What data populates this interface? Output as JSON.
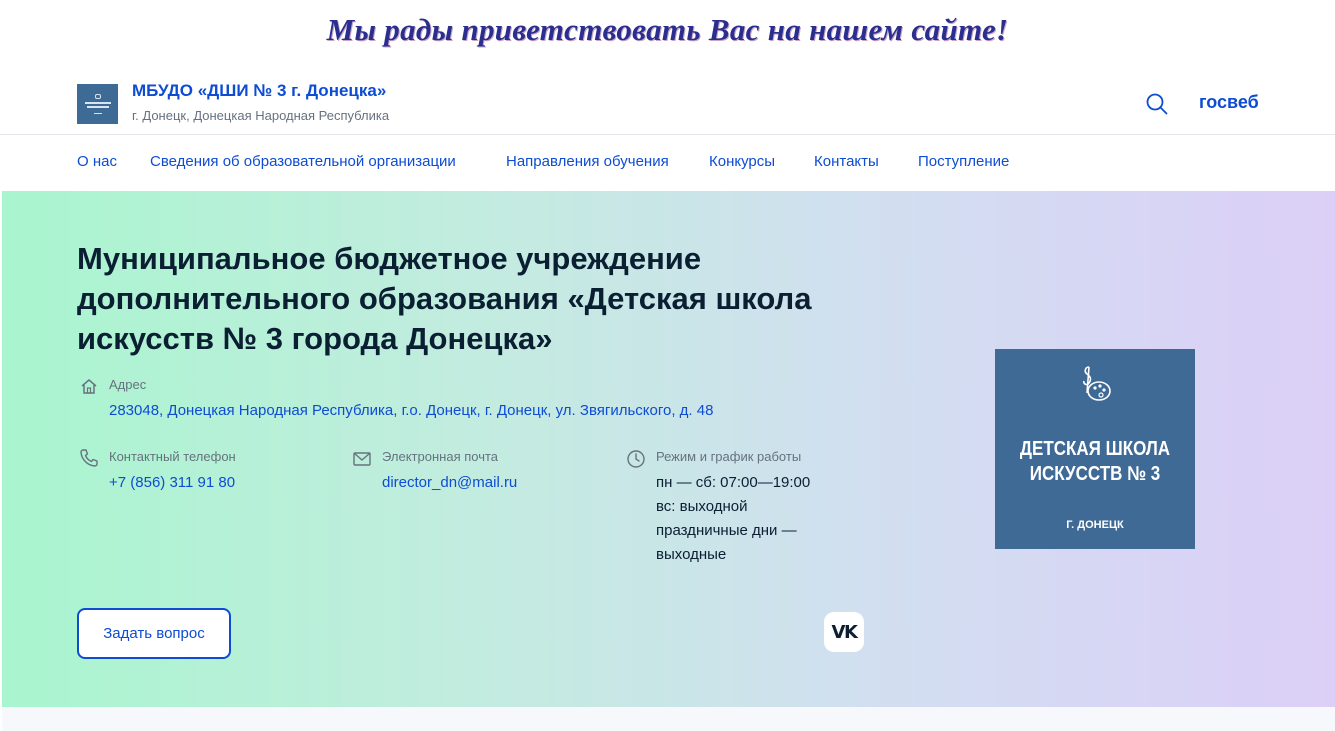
{
  "welcome_banner": "Мы рады приветствовать Вас на нашем сайте!",
  "header": {
    "org_name": "МБУДО «ДШИ № 3 г. Донецка»",
    "org_subtitle": "г. Донецк, Донецкая Народная Республика",
    "search_icon": "search-icon",
    "gosweb_label": "госвеб"
  },
  "nav": {
    "items": [
      {
        "label": "О нас"
      },
      {
        "label": "Сведения об образовательной организации"
      },
      {
        "label": "Направления обучения"
      },
      {
        "label": "Конкурсы"
      },
      {
        "label": "Контакты"
      },
      {
        "label": "Поступление"
      }
    ]
  },
  "hero": {
    "title": "Муниципальное бюджетное учреждение дополнительного образования «Детская школа искусств № 3 города Донецка»",
    "address": {
      "icon": "home-icon",
      "label": "Адрес",
      "value": "283048, Донецкая Народная Республика, г.о. Донецк, г. Донецк, ул. Звягильского, д. 48"
    },
    "phone": {
      "icon": "phone-icon",
      "label": "Контактный телефон",
      "value": "+7 (856) 311 91 80"
    },
    "email": {
      "icon": "mail-icon",
      "label": "Электронная почта",
      "value": "director_dn@mail.ru"
    },
    "schedule": {
      "icon": "clock-icon",
      "label": "Режим и график работы",
      "lines": [
        "пн — сб: 07:00—19:00",
        "вс: выходной",
        "праздничные дни —",
        "выходные"
      ]
    },
    "ask_button": "Задать вопрос",
    "vk_label": "VK",
    "card": {
      "icon": "music-palette-icon",
      "title_line1": "ДЕТСКАЯ ШКОЛА",
      "title_line2": "ИСКУССТВ № 3",
      "subtitle": "Г. ДОНЕЦК"
    }
  },
  "colors": {
    "accent": "#0d4cd3",
    "text": "#0b1f33",
    "muted": "#66727f",
    "card_bg": "#3f6a96",
    "gradient_start": "#a9f5cf",
    "gradient_end": "#dccff7"
  }
}
